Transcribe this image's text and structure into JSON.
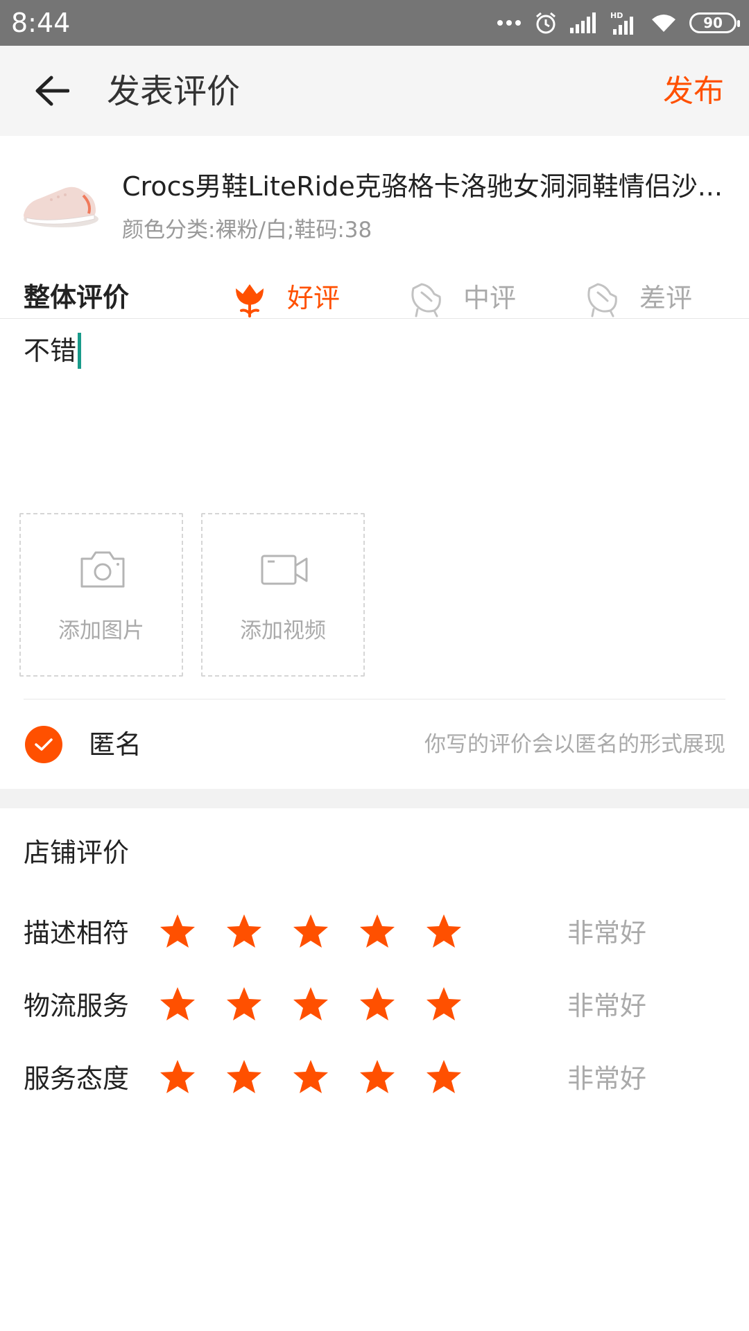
{
  "status_bar": {
    "time": "8:44",
    "battery": "90",
    "icons": [
      "more-dots-icon",
      "alarm-icon",
      "signal-icon",
      "hd-signal-icon",
      "wifi-icon",
      "battery-icon"
    ]
  },
  "header": {
    "back_icon": "arrow-left-icon",
    "title": "发表评价",
    "publish_label": "发布",
    "accent_color": "#ff5000"
  },
  "product": {
    "title": "Crocs男鞋LiteRide克骆格卡洛驰女洞洞鞋情侣沙...",
    "spec": "颜色分类:裸粉/白;鞋码:38"
  },
  "overall_rating": {
    "label": "整体评价",
    "options": [
      {
        "label": "好评",
        "icon": "flower-icon",
        "selected": true
      },
      {
        "label": "中评",
        "icon": "flower-outline-icon",
        "selected": false
      },
      {
        "label": "差评",
        "icon": "flower-outline-icon",
        "selected": false
      }
    ]
  },
  "review": {
    "text": "不错"
  },
  "media": {
    "add_photo_label": "添加图片",
    "add_video_label": "添加视频"
  },
  "anonymous": {
    "label": "匿名",
    "checked": true,
    "hint": "你写的评价会以匿名的形式展现"
  },
  "shop_rating": {
    "title": "店铺评价",
    "rows": [
      {
        "label": "描述相符",
        "stars": 5,
        "max": 5,
        "value_text": "非常好"
      },
      {
        "label": "物流服务",
        "stars": 5,
        "max": 5,
        "value_text": "非常好"
      },
      {
        "label": "服务态度",
        "stars": 5,
        "max": 5,
        "value_text": "非常好"
      }
    ]
  }
}
